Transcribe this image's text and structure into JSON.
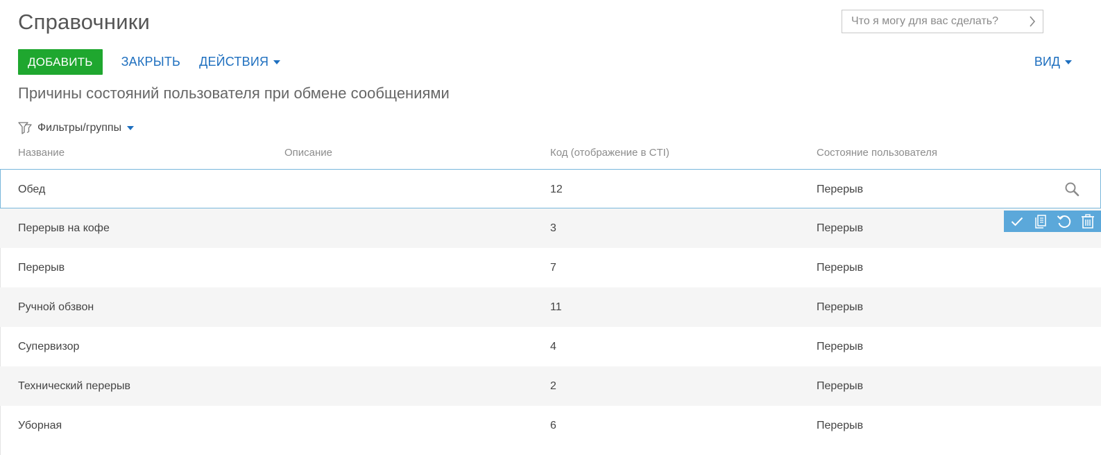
{
  "page": {
    "title": "Справочники"
  },
  "search": {
    "placeholder": "Что я могу для вас сделать?",
    "go_icon": "chevron-right-icon"
  },
  "toolbar": {
    "add_label": "ДОБАВИТЬ",
    "close_label": "ЗАКРЫТЬ",
    "actions_label": "ДЕЙСТВИЯ",
    "view_label": "ВИД"
  },
  "section": {
    "title": "Причины состояний пользователя при обмене сообщениями"
  },
  "filters": {
    "label": "Фильтры/группы",
    "icon": "filter-icon"
  },
  "grid": {
    "columns": [
      "Название",
      "Описание",
      "Код (отображение в CTI)",
      "Состояние пользователя"
    ],
    "rows": [
      {
        "name": "Обед",
        "description": "",
        "code": "12",
        "state": "Перерыв"
      },
      {
        "name": "Перерыв на кофе",
        "description": "",
        "code": "3",
        "state": "Перерыв"
      },
      {
        "name": "Перерыв",
        "description": "",
        "code": "7",
        "state": "Перерыв"
      },
      {
        "name": "Ручной обзвон",
        "description": "",
        "code": "11",
        "state": "Перерыв"
      },
      {
        "name": "Супервизор",
        "description": "",
        "code": "4",
        "state": "Перерыв"
      },
      {
        "name": "Технический перерыв",
        "description": "",
        "code": "2",
        "state": "Перерыв"
      },
      {
        "name": "Уборная",
        "description": "",
        "code": "6",
        "state": "Перерыв"
      }
    ]
  },
  "row_actions": [
    "check-icon",
    "copy-icon",
    "undo-icon",
    "trash-icon"
  ],
  "colors": {
    "accent_green": "#1fa72f",
    "link_blue": "#1e6fbf",
    "action_bar": "#5ba8da",
    "active_row_border": "#77b6db"
  }
}
